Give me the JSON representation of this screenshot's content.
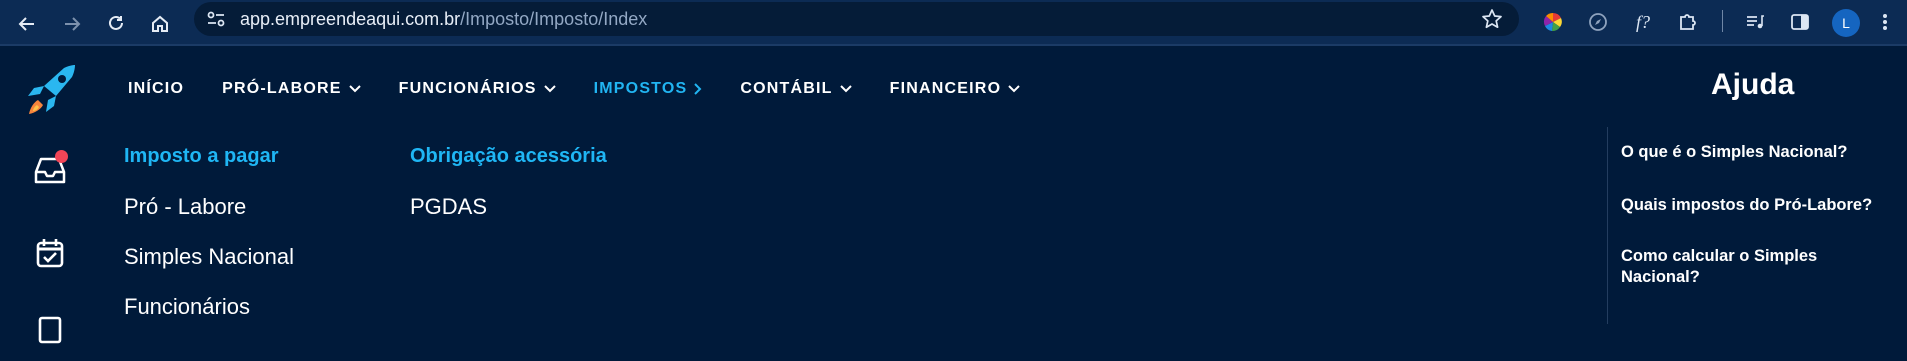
{
  "browser": {
    "url_host": "app.empreendeaqui.com.br",
    "url_path": "/Imposto/Imposto/Index",
    "profile_initial": "L",
    "ext_function_label": "f?"
  },
  "nav": {
    "items": [
      {
        "label": "INÍCIO",
        "has_chevron": false,
        "active": false
      },
      {
        "label": "PRÓ-LABORE",
        "has_chevron": true,
        "active": false
      },
      {
        "label": "FUNCIONÁRIOS",
        "has_chevron": true,
        "active": false
      },
      {
        "label": "IMPOSTOS",
        "has_chevron": true,
        "active": true
      },
      {
        "label": "CONTÁBIL",
        "has_chevron": true,
        "active": false
      },
      {
        "label": "FINANCEIRO",
        "has_chevron": true,
        "active": false
      }
    ]
  },
  "menu": {
    "col1_title": "Imposto a pagar",
    "col1_items": [
      "Pró - Labore",
      "Simples Nacional",
      "Funcionários"
    ],
    "col2_title": "Obrigação acessória",
    "col2_items": [
      "PGDAS"
    ]
  },
  "help": {
    "title": "Ajuda",
    "links": [
      "O que é o Simples Nacional?",
      "Quais impostos do Pró-Labore?",
      "Como calcular o Simples Nacional?"
    ]
  },
  "colors": {
    "page_bg": "#001a3a",
    "accent": "#21b5f2",
    "badge": "#f14557",
    "chrome_bg": "#0c2b54"
  }
}
